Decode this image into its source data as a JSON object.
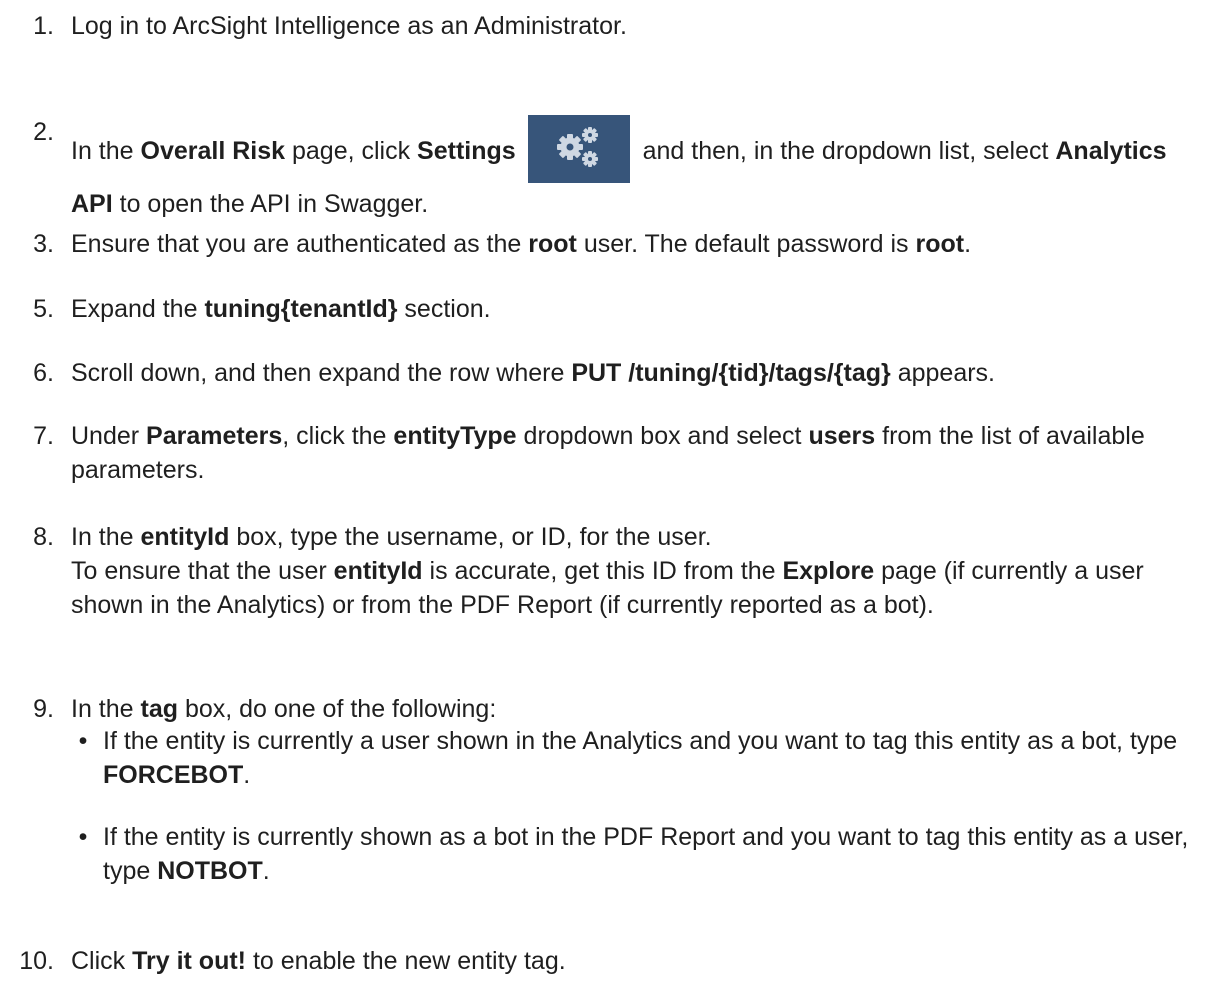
{
  "steps": [
    {
      "num": "1.",
      "parts": [
        {
          "t": "Log in to ArcSight Intelligence as an Administrator."
        }
      ]
    },
    {
      "num": "2.",
      "parts": [
        {
          "t": "In the "
        },
        {
          "t": "Overall Risk",
          "b": true
        },
        {
          "t": " page, click "
        },
        {
          "t": "Settings",
          "b": true
        },
        {
          "icon": "settings-gear-icon"
        },
        {
          "t": " and then, in the dropdown list, select "
        },
        {
          "t": "Analytics API",
          "b": true
        },
        {
          "t": " to open the API in Swagger."
        }
      ]
    },
    {
      "num": "3.",
      "parts": [
        {
          "t": "Ensure that you are authenticated as the "
        },
        {
          "t": "root",
          "b": true
        },
        {
          "t": " user. The default password is "
        },
        {
          "t": "root",
          "b": true
        },
        {
          "t": "."
        }
      ]
    },
    {
      "num": "5.",
      "parts": [
        {
          "t": "Expand the "
        },
        {
          "t": "tuning{tenantId}",
          "b": true
        },
        {
          "t": " section."
        }
      ]
    },
    {
      "num": "6.",
      "parts": [
        {
          "t": "Scroll down, and then expand the row where "
        },
        {
          "t": "PUT /tuning/{tid}/tags/{tag}",
          "b": true
        },
        {
          "t": " appears."
        }
      ]
    },
    {
      "num": "7.",
      "parts": [
        {
          "t": "Under "
        },
        {
          "t": "Parameters",
          "b": true
        },
        {
          "t": ", click the "
        },
        {
          "t": "entityType",
          "b": true
        },
        {
          "t": " dropdown box and select "
        },
        {
          "t": "users",
          "b": true
        },
        {
          "t": " from the list of available parameters."
        }
      ]
    },
    {
      "num": "8.",
      "parts": [
        {
          "t": "In the "
        },
        {
          "t": "entityId",
          "b": true
        },
        {
          "t": " box, type the username, or ID, for the user."
        },
        {
          "br": true
        },
        {
          "t": "To ensure that the user "
        },
        {
          "t": "entityId",
          "b": true
        },
        {
          "t": " is accurate, get this ID from the "
        },
        {
          "t": "Explore",
          "b": true
        },
        {
          "t": " page (if currently a user shown in the Analytics) or from the PDF Report (if currently reported as a bot)."
        }
      ]
    },
    {
      "num": "9.",
      "parts": [
        {
          "t": "In the "
        },
        {
          "t": "tag",
          "b": true
        },
        {
          "t": " box, do one of the following:"
        }
      ]
    },
    {
      "num": "10.",
      "parts": [
        {
          "t": "Click "
        },
        {
          "t": "Try it out!",
          "b": true
        },
        {
          "t": " to enable the new entity tag."
        }
      ]
    }
  ],
  "bullets": [
    {
      "parts": [
        {
          "t": "If the entity is currently a user shown in the Analytics and you want to tag this entity as a bot, type "
        },
        {
          "t": "FORCEBOT",
          "b": true
        },
        {
          "t": "."
        }
      ]
    },
    {
      "parts": [
        {
          "t": "If the entity is currently shown as a bot in the PDF Report and you want to tag this entity as a user, type "
        },
        {
          "t": "NOTBOT",
          "b": true
        },
        {
          "t": "."
        }
      ]
    }
  ],
  "bullet_char": "•",
  "colors": {
    "text": "#1f1f1f",
    "icon_bg": "#37557a",
    "icon_fg": "#cfd8e3"
  }
}
